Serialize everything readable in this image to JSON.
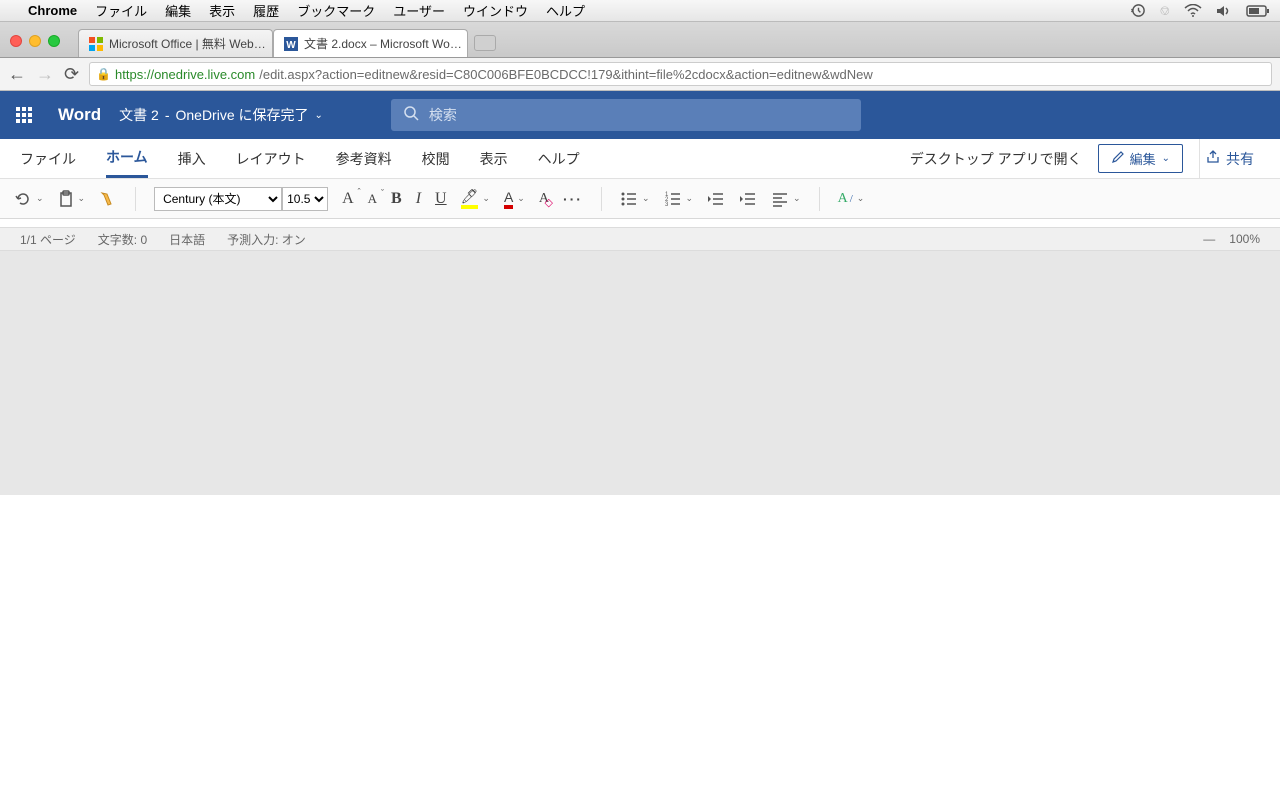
{
  "mac_menu": {
    "app": "Chrome",
    "items": [
      "ファイル",
      "編集",
      "表示",
      "履歴",
      "ブックマーク",
      "ユーザー",
      "ウインドウ",
      "ヘルプ"
    ]
  },
  "browser": {
    "tabs": [
      {
        "title": "Microsoft Office | 無料 Web…"
      },
      {
        "title": "文書 2.docx – Microsoft Wo…"
      }
    ],
    "url_secure": "https://onedrive.live.com",
    "url_path": "/edit.aspx?action=editnew&resid=C80C006BFE0BCDCC!179&ithint=file%2cdocx&action=editnew&wdNew"
  },
  "word": {
    "app_name": "Word",
    "doc_name": "文書 2",
    "save_status": "OneDrive に保存完了",
    "search_placeholder": "検索"
  },
  "ribbon": {
    "tabs": [
      "ファイル",
      "ホーム",
      "挿入",
      "レイアウト",
      "参考資料",
      "校閲",
      "表示",
      "ヘルプ"
    ],
    "active": "ホーム",
    "open_desktop": "デスクトップ アプリで開く",
    "edit": "編集",
    "share": "共有"
  },
  "toolbar": {
    "font_name": "Century (本文)",
    "font_size": "10.5"
  },
  "status": {
    "page": "1/1 ページ",
    "words": "文字数: 0",
    "lang": "日本語",
    "predict": "予測入力: オン",
    "zoom": "100%"
  }
}
